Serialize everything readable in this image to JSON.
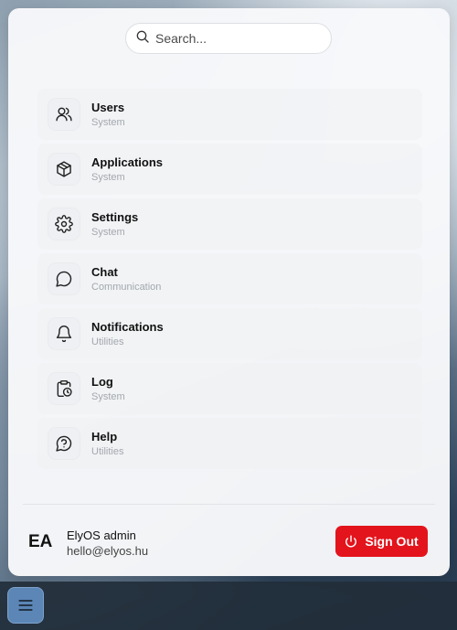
{
  "search": {
    "placeholder": "Search..."
  },
  "apps": [
    {
      "name": "Users",
      "category": "System",
      "icon": "users-icon"
    },
    {
      "name": "Applications",
      "category": "System",
      "icon": "box-icon"
    },
    {
      "name": "Settings",
      "category": "System",
      "icon": "gear-icon"
    },
    {
      "name": "Chat",
      "category": "Communication",
      "icon": "chat-icon"
    },
    {
      "name": "Notifications",
      "category": "Utilities",
      "icon": "bell-icon"
    },
    {
      "name": "Log",
      "category": "System",
      "icon": "clipboard-clock-icon"
    },
    {
      "name": "Help",
      "category": "Utilities",
      "icon": "help-circle-icon"
    }
  ],
  "user": {
    "initials": "EA",
    "name": "ElyOS admin",
    "email": "hello@elyos.hu"
  },
  "signout": {
    "label": "Sign Out",
    "icon": "power-icon"
  },
  "taskbar": {
    "start_icon": "menu-icon"
  },
  "colors": {
    "accent_red": "#e3141c",
    "panel_bg": "#f7f8fa",
    "start_button": "#5b86b6"
  }
}
